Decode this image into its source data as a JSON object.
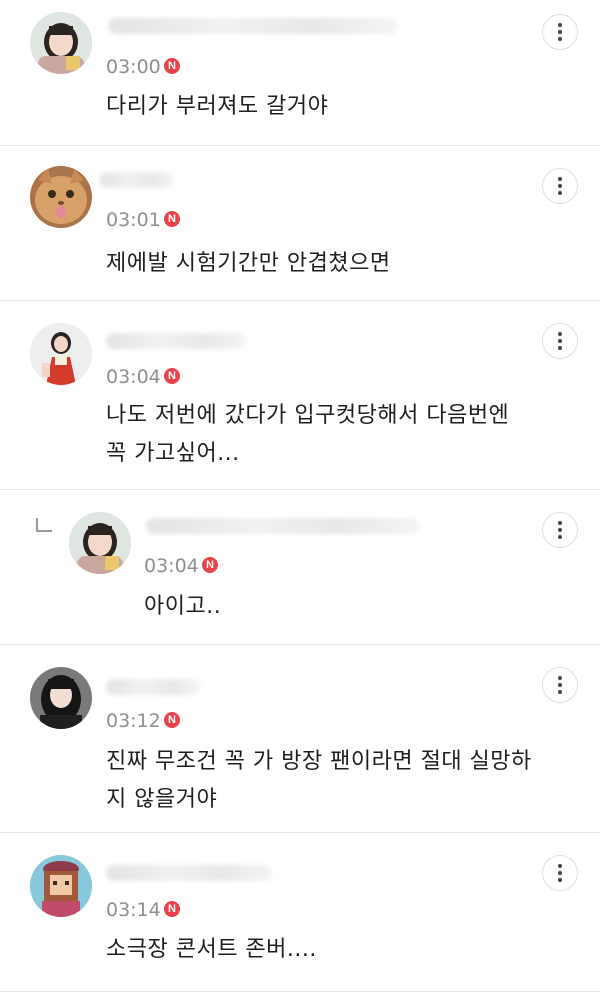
{
  "comments": [
    {
      "time": "03:00",
      "badge": "N",
      "text": "다리가 부러져도 갈거야",
      "avatar": "girl-portrait-avatar",
      "reply": false
    },
    {
      "time": "03:01",
      "badge": "N",
      "text": "제에발 시험기간만 안겹쳤으면",
      "avatar": "cat-avatar",
      "reply": false
    },
    {
      "time": "03:04",
      "badge": "N",
      "text": "나도 저번에 갔다가 입구컷당해서 다음번엔\n꼭 가고싶어...",
      "avatar": "girl-hanbok-avatar",
      "reply": false
    },
    {
      "time": "03:04",
      "badge": "N",
      "text": "아이고..",
      "avatar": "girl-portrait-avatar",
      "reply": true
    },
    {
      "time": "03:12",
      "badge": "N",
      "text": "진짜 무조건 꼭 가 방장 팬이라면 절대 실망하\n지 않을거야",
      "avatar": "dark-hair-avatar",
      "reply": false
    },
    {
      "time": "03:14",
      "badge": "N",
      "text": "소극장 콘서트 존버....",
      "avatar": "pixel-character-avatar",
      "reply": false
    }
  ],
  "icons": {
    "more": "more-vertical-icon",
    "reply": "reply-arrow-icon",
    "new_badge": "new-badge-icon"
  },
  "colors": {
    "badge": "#e8424a",
    "time": "#8f8f8f",
    "divider": "#e4e4e4"
  }
}
